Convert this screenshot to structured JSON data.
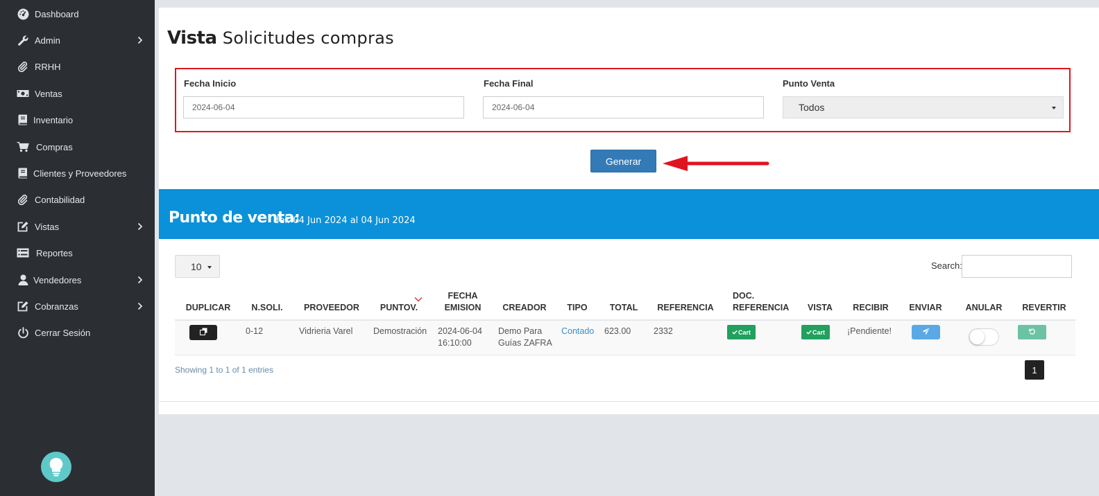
{
  "sidebar": {
    "items": [
      {
        "label": "Dashboard",
        "icon": "dashboard-icon"
      },
      {
        "label": "Admin",
        "icon": "wrench-icon",
        "has_children": true
      },
      {
        "label": "RRHH",
        "icon": "paperclip-icon"
      },
      {
        "label": "Ventas",
        "icon": "money-icon"
      },
      {
        "label": "Inventario",
        "icon": "book-icon"
      },
      {
        "label": "Compras",
        "icon": "cart-icon"
      },
      {
        "label": "Clientes y Proveedores",
        "icon": "book-icon"
      },
      {
        "label": "Contabilidad",
        "icon": "paperclip-icon"
      },
      {
        "label": "Vistas",
        "icon": "edit-icon",
        "has_children": true
      },
      {
        "label": "Reportes",
        "icon": "list-icon"
      },
      {
        "label": "Vendedores",
        "icon": "user-icon",
        "has_children": true
      },
      {
        "label": "Cobranzas",
        "icon": "edit-icon",
        "has_children": true
      },
      {
        "label": "Cerrar Sesión",
        "icon": "power-icon"
      }
    ],
    "help_icon": "lightbulb-icon"
  },
  "page": {
    "title_bold": "Vista",
    "title_light": "Solicitudes compras"
  },
  "filters": {
    "fecha_inicio_label": "Fecha Inicio",
    "fecha_inicio_value": "2024-06-04",
    "fecha_final_label": "Fecha Final",
    "fecha_final_value": "2024-06-04",
    "punto_venta_label": "Punto Venta",
    "punto_venta_value": "Todos"
  },
  "generate_button": "Generar",
  "colors": {
    "sidebar_bg": "#2b2e33",
    "banner_bg": "#0a91da",
    "highlight_red": "#e0141e",
    "primary_button": "#337ab7",
    "success_green": "#21a05e"
  },
  "banner": {
    "title": "Punto de venta:",
    "subtitle": "del: 04 Jun 2024 al 04 Jun 2024"
  },
  "table_controls": {
    "page_length": "10",
    "search_label": "Search:"
  },
  "table": {
    "headers": {
      "duplicar": "DUPLICAR",
      "nsoli": "N.SOLI.",
      "proveedor": "PROVEEDOR",
      "puntov": "PUNTOV.",
      "fecha_1": "FECHA",
      "fecha_2": "EMISION",
      "creador": "CREADOR",
      "tipo": "TIPO",
      "total": "TOTAL",
      "referencia": "REFERENCIA",
      "docref_1": "DOC.",
      "docref_2": "REFERENCIA",
      "vista": "VISTA",
      "recibir": "RECIBIR",
      "enviar": "ENVIAR",
      "anular": "ANULAR",
      "revertir": "REVERTIR"
    },
    "rows": [
      {
        "nsoli": "0-12",
        "proveedor": "Vidrieria Varel",
        "puntov": "Demostración",
        "fecha_1": "2024-06-04",
        "fecha_2": "16:10:00",
        "creador_1": "Demo Para",
        "creador_2": "Guías ZAFRA",
        "tipo": "Contado",
        "total": "623.00",
        "referencia": "2332",
        "docref_btn": "Cart",
        "vista_btn": "Cart",
        "recibir": "¡Pendiente!",
        "anular_on": false
      }
    ]
  },
  "footer": {
    "info": "Showing 1 to 1 of 1 entries",
    "current_page": "1"
  }
}
